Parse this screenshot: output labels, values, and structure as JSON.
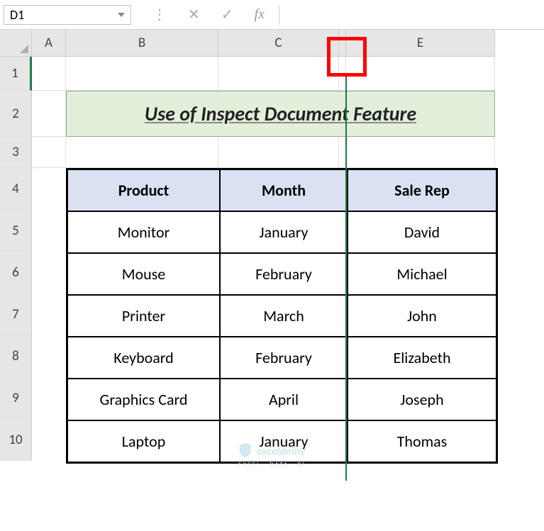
{
  "name_box": "D1",
  "fx_label": "fx",
  "col_headers": {
    "A": "A",
    "B": "B",
    "C": "C",
    "E": "E"
  },
  "row_numbers": [
    "1",
    "2",
    "3",
    "4",
    "5",
    "6",
    "7",
    "8",
    "9",
    "10"
  ],
  "title": "Use of Inspect Document Feature",
  "table": {
    "headers": {
      "product": "Product",
      "month": "Month",
      "rep": "Sale Rep"
    },
    "rows": [
      {
        "product": "Monitor",
        "month": "January",
        "rep": "David"
      },
      {
        "product": "Mouse",
        "month": "February",
        "rep": "Michael"
      },
      {
        "product": "Printer",
        "month": "March",
        "rep": "John"
      },
      {
        "product": "Keyboard",
        "month": "February",
        "rep": "Elizabeth"
      },
      {
        "product": "Graphics Card",
        "month": "April",
        "rep": "Joseph"
      },
      {
        "product": "Laptop",
        "month": "January",
        "rep": "Thomas"
      }
    ]
  },
  "watermark": {
    "main": "exceldemy",
    "sub": "EXCEL · DATA · BI"
  },
  "colors": {
    "title_bg": "#e2efda",
    "header_bg": "#d9e1f2",
    "selection": "#1a7a4a",
    "highlight": "#ff0000"
  },
  "layout": {
    "col_widths": {
      "A": 48,
      "B": 215,
      "C": 170,
      "D_hidden": 10,
      "E": 210
    },
    "row_heights": {
      "1": 48,
      "2": 65,
      "3": 44,
      "data": 59
    }
  }
}
